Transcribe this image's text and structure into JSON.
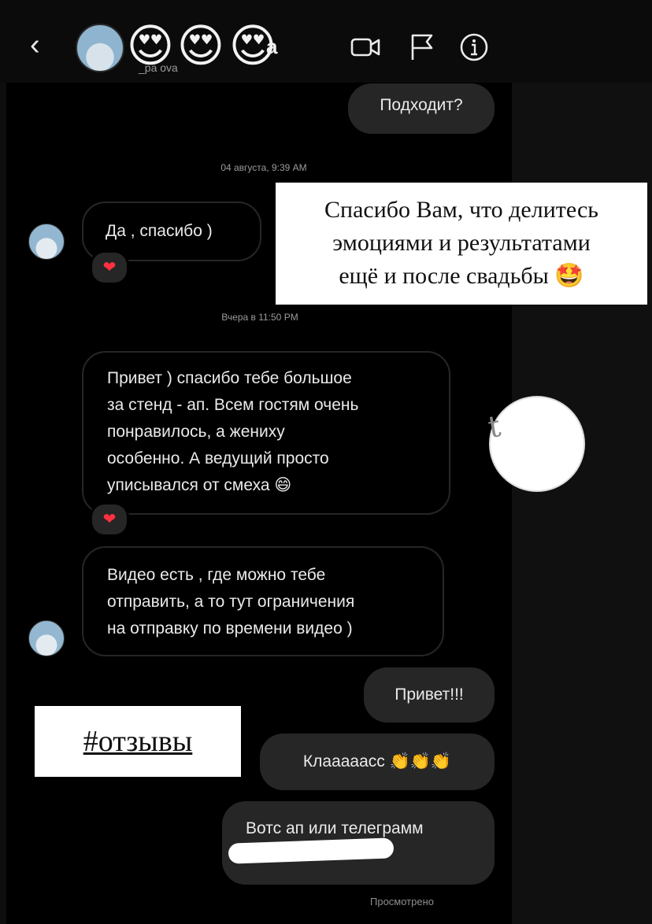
{
  "header": {
    "back_glyph": "‹",
    "name_fragment": "a",
    "username_fragment": "_ра     ova",
    "emojis": [
      "😍",
      "😍",
      "😍"
    ],
    "icons": [
      "video-camera-icon",
      "flag-icon",
      "info-icon"
    ]
  },
  "messages": {
    "m1": "Подходит?",
    "ts1": "04 августа, 9:39 AM",
    "m2": "Да , спасибо )",
    "ts2": "Вчера в 11:50 PM",
    "m3_lines": [
      "Привет ) спасибо тебе большое",
      "за стенд - ап. Всем гостям очень",
      "понравилось, а жениху",
      "особенно. А ведущий просто",
      "уписывался от смеха 😄"
    ],
    "m4_lines": [
      "Видео есть , где можно тебе",
      "отправить, а то тут ограничения",
      "на отправку по времени видео )"
    ],
    "m5": "Привет!!!",
    "m6": "Клааааасс 👏👏👏",
    "m7": "Вотс ап или телеграмм",
    "seen": "Просмотрено",
    "reaction": "❤"
  },
  "overlay": {
    "caption_lines": [
      "Спасибо Вам, что делитесь",
      "эмоциями и результатами",
      "ещё и после свадьбы 🤩"
    ],
    "hashtag": "#отзывы",
    "handwriting": "t"
  }
}
